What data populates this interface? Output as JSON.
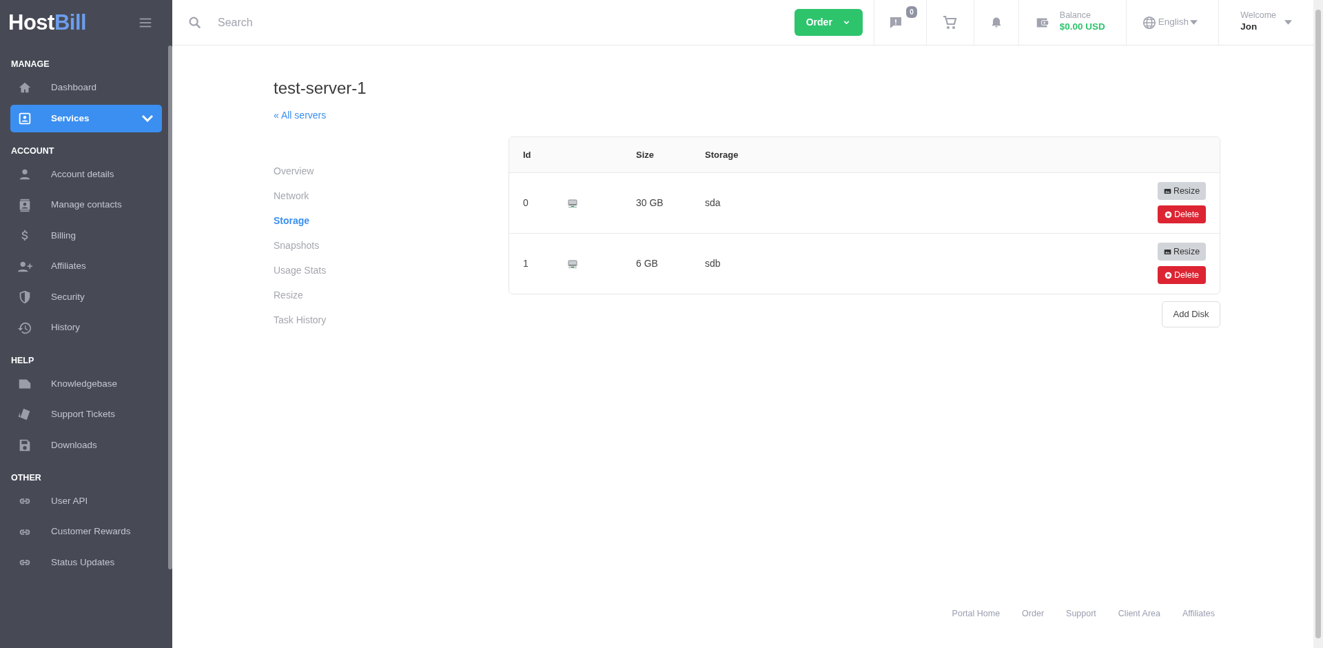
{
  "brand": {
    "first": "Host",
    "second": "Bill"
  },
  "search": {
    "placeholder": "Search"
  },
  "topbar": {
    "order_button": "Order",
    "messages_count": "0",
    "balance_label": "Balance",
    "balance_value": "$0.00 USD",
    "language": "English",
    "welcome": "Welcome",
    "user": "Jon"
  },
  "sidebar": {
    "sections": [
      {
        "title": "MANAGE",
        "items": [
          {
            "label": "Dashboard",
            "kind": "home",
            "selected": false,
            "has_submenu": false
          },
          {
            "label": "Services",
            "kind": "card",
            "selected": true,
            "has_submenu": true
          }
        ]
      },
      {
        "title": "ACCOUNT",
        "items": [
          {
            "label": "Account details",
            "kind": "user",
            "selected": false,
            "has_submenu": false
          },
          {
            "label": "Manage contacts",
            "kind": "contacts",
            "selected": false,
            "has_submenu": false
          },
          {
            "label": "Billing",
            "kind": "dollar",
            "selected": false,
            "has_submenu": false
          },
          {
            "label": "Affiliates",
            "kind": "userplus",
            "selected": false,
            "has_submenu": false
          },
          {
            "label": "Security",
            "kind": "shield",
            "selected": false,
            "has_submenu": false
          },
          {
            "label": "History",
            "kind": "history",
            "selected": false,
            "has_submenu": false
          }
        ]
      },
      {
        "title": "HELP",
        "items": [
          {
            "label": "Knowledgebase",
            "kind": "doc",
            "selected": false,
            "has_submenu": false
          },
          {
            "label": "Support Tickets",
            "kind": "ticket",
            "selected": false,
            "has_submenu": false
          },
          {
            "label": "Downloads",
            "kind": "floppy",
            "selected": false,
            "has_submenu": false
          }
        ]
      },
      {
        "title": "OTHER",
        "items": [
          {
            "label": "User API",
            "kind": "link",
            "selected": false,
            "has_submenu": false
          },
          {
            "label": "Customer Rewards",
            "kind": "link",
            "selected": false,
            "has_submenu": false
          },
          {
            "label": "Status Updates",
            "kind": "link",
            "selected": false,
            "has_submenu": false
          }
        ]
      }
    ]
  },
  "server": {
    "title": "test-server-1",
    "back_link": "« All servers"
  },
  "tabs": [
    {
      "label": "Overview",
      "selected": false
    },
    {
      "label": "Network",
      "selected": false
    },
    {
      "label": "Storage",
      "selected": true
    },
    {
      "label": "Snapshots",
      "selected": false
    },
    {
      "label": "Usage Stats",
      "selected": false
    },
    {
      "label": "Resize",
      "selected": false
    },
    {
      "label": "Task History",
      "selected": false
    }
  ],
  "disks": {
    "columns": [
      "Id",
      "Size",
      "Storage"
    ],
    "rows": [
      {
        "id": "0",
        "size": "30 GB",
        "storage": "sda",
        "actions": [
          {
            "label": "Resize",
            "kind": "resize"
          },
          {
            "label": "Delete",
            "kind": "delete"
          }
        ]
      },
      {
        "id": "1",
        "size": "6 GB",
        "storage": "sdb",
        "actions": [
          {
            "label": "Resize",
            "kind": "resize"
          },
          {
            "label": "Delete",
            "kind": "delete"
          }
        ]
      }
    ],
    "add_button": "Add Disk"
  },
  "footer_links": [
    "Portal Home",
    "Order",
    "Support",
    "Client Area",
    "Affiliates"
  ]
}
